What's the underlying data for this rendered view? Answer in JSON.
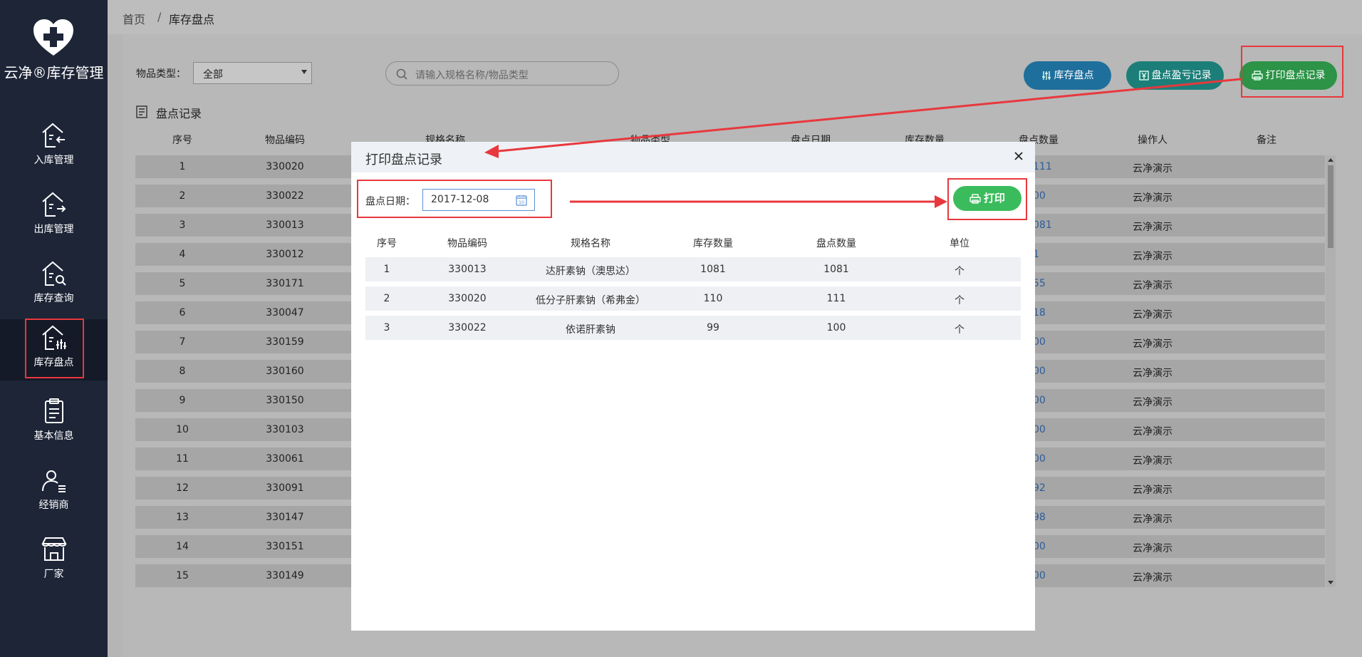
{
  "brand": {
    "name": "云净®库存管理",
    "logo_icon": "heart-cross-icon"
  },
  "sidebar": {
    "items": [
      {
        "label": "入库管理",
        "icon": "warehouse-in-icon"
      },
      {
        "label": "出库管理",
        "icon": "warehouse-out-icon"
      },
      {
        "label": "库存查询",
        "icon": "warehouse-search-icon"
      },
      {
        "label": "库存盘点",
        "icon": "warehouse-count-icon",
        "active": true
      },
      {
        "label": "基本信息",
        "icon": "clipboard-icon"
      },
      {
        "label": "经销商",
        "icon": "user-list-icon"
      },
      {
        "label": "厂家",
        "icon": "store-icon"
      }
    ]
  },
  "breadcrumb": {
    "home": "首页",
    "separator": "/",
    "current": "库存盘点"
  },
  "filters": {
    "type_label": "物品类型：",
    "type_value": "全部",
    "search_placeholder": "请输入规格名称/物品类型"
  },
  "toolbar": {
    "stocktake_label": "库存盘点",
    "profit_loss_label": "盘点盈亏记录",
    "print_records_label": "打印盘点记录"
  },
  "records": {
    "title": "盘点记录",
    "columns": [
      "序号",
      "物品编码",
      "规格名称",
      "物品类型",
      "盘点日期",
      "库存数量",
      "盘点数量",
      "操作人",
      "备注"
    ],
    "rows": [
      {
        "no": "1",
        "code": "330020",
        "count": "111",
        "operator": "云净演示"
      },
      {
        "no": "2",
        "code": "330022",
        "count": "00",
        "operator": "云净演示"
      },
      {
        "no": "3",
        "code": "330013",
        "count": "081",
        "operator": "云净演示"
      },
      {
        "no": "4",
        "code": "330012",
        "count": "1",
        "operator": "云净演示"
      },
      {
        "no": "5",
        "code": "330171",
        "count": "55",
        "operator": "云净演示"
      },
      {
        "no": "6",
        "code": "330047",
        "count": "18",
        "operator": "云净演示"
      },
      {
        "no": "7",
        "code": "330159",
        "count": "00",
        "operator": "云净演示"
      },
      {
        "no": "8",
        "code": "330160",
        "count": "00",
        "operator": "云净演示"
      },
      {
        "no": "9",
        "code": "330150",
        "count": "00",
        "operator": "云净演示"
      },
      {
        "no": "10",
        "code": "330103",
        "count": "00",
        "operator": "云净演示"
      },
      {
        "no": "11",
        "code": "330061",
        "count": "00",
        "operator": "云净演示"
      },
      {
        "no": "12",
        "code": "330091",
        "count": "92",
        "operator": "云净演示"
      },
      {
        "no": "13",
        "code": "330147",
        "count": "98",
        "operator": "云净演示"
      },
      {
        "no": "14",
        "code": "330151",
        "count": "00",
        "operator": "云净演示"
      },
      {
        "no": "15",
        "code": "330149",
        "count": "00",
        "operator": "云净演示"
      }
    ]
  },
  "modal": {
    "title": "打印盘点记录",
    "date_label": "盘点日期：",
    "date_value": "2017-12-08",
    "print_label": "打印",
    "columns": [
      "序号",
      "物品编码",
      "规格名称",
      "库存数量",
      "盘点数量",
      "单位"
    ],
    "rows": [
      {
        "no": "1",
        "code": "330013",
        "name": "达肝素钠（澳思达）",
        "stock": "1081",
        "count": "1081",
        "unit": "个"
      },
      {
        "no": "2",
        "code": "330020",
        "name": "低分子肝素钠（希弗金）",
        "stock": "110",
        "count": "111",
        "unit": "个"
      },
      {
        "no": "3",
        "code": "330022",
        "name": "依诺肝素钠",
        "stock": "99",
        "count": "100",
        "unit": "个"
      }
    ]
  },
  "colors": {
    "sidebar_bg": "#1d2537",
    "blue_button": "#2e8fd0",
    "teal_button": "#23a39c",
    "green_button": "#3bbc5c",
    "annotation_red": "#e8383d"
  }
}
